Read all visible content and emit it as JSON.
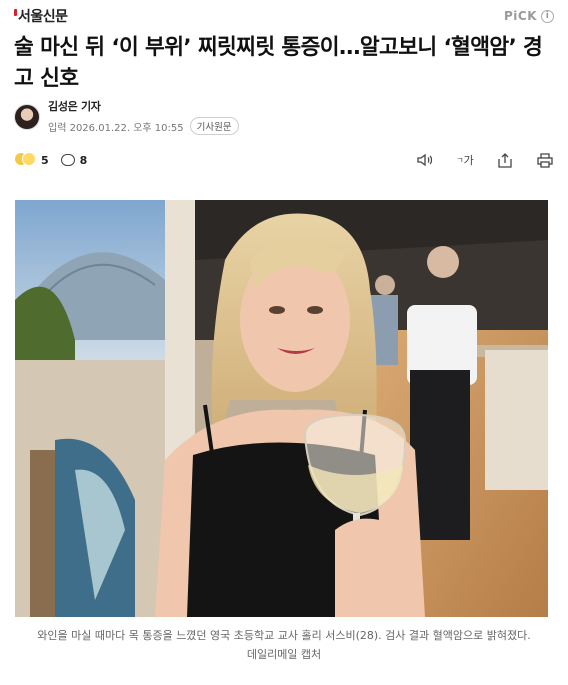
{
  "header": {
    "publisher": "서울신문",
    "pick_label": "PiCK",
    "info_icon": "info-circle-icon"
  },
  "article": {
    "title": "술 마신 뒤 ‘이 부위’ 찌릿찌릿 통증이…알고보니 ‘혈액암’ 경고 신호",
    "reporter": "김성은 기자",
    "date_label": "입력 2026.01.22. 오후 10:55",
    "original_button": "기사원문"
  },
  "toolbar": {
    "reaction_count": "5",
    "comment_count": "8",
    "font_size_label": "가",
    "icons": [
      "speaker-icon",
      "font-size-icon",
      "share-icon",
      "print-icon"
    ]
  },
  "photo": {
    "caption_line1": "와인을 마실 때마다 목 통증을 느꼈던 영국 초등학교 교사 홀리 서스비(28). 검사 결과 혈액암으로 밝혀졌다.",
    "caption_line2": "데일리메일 캡처"
  },
  "colors": {
    "brand_red": "#d2232a",
    "text_primary": "#111111",
    "text_muted": "#777777"
  }
}
